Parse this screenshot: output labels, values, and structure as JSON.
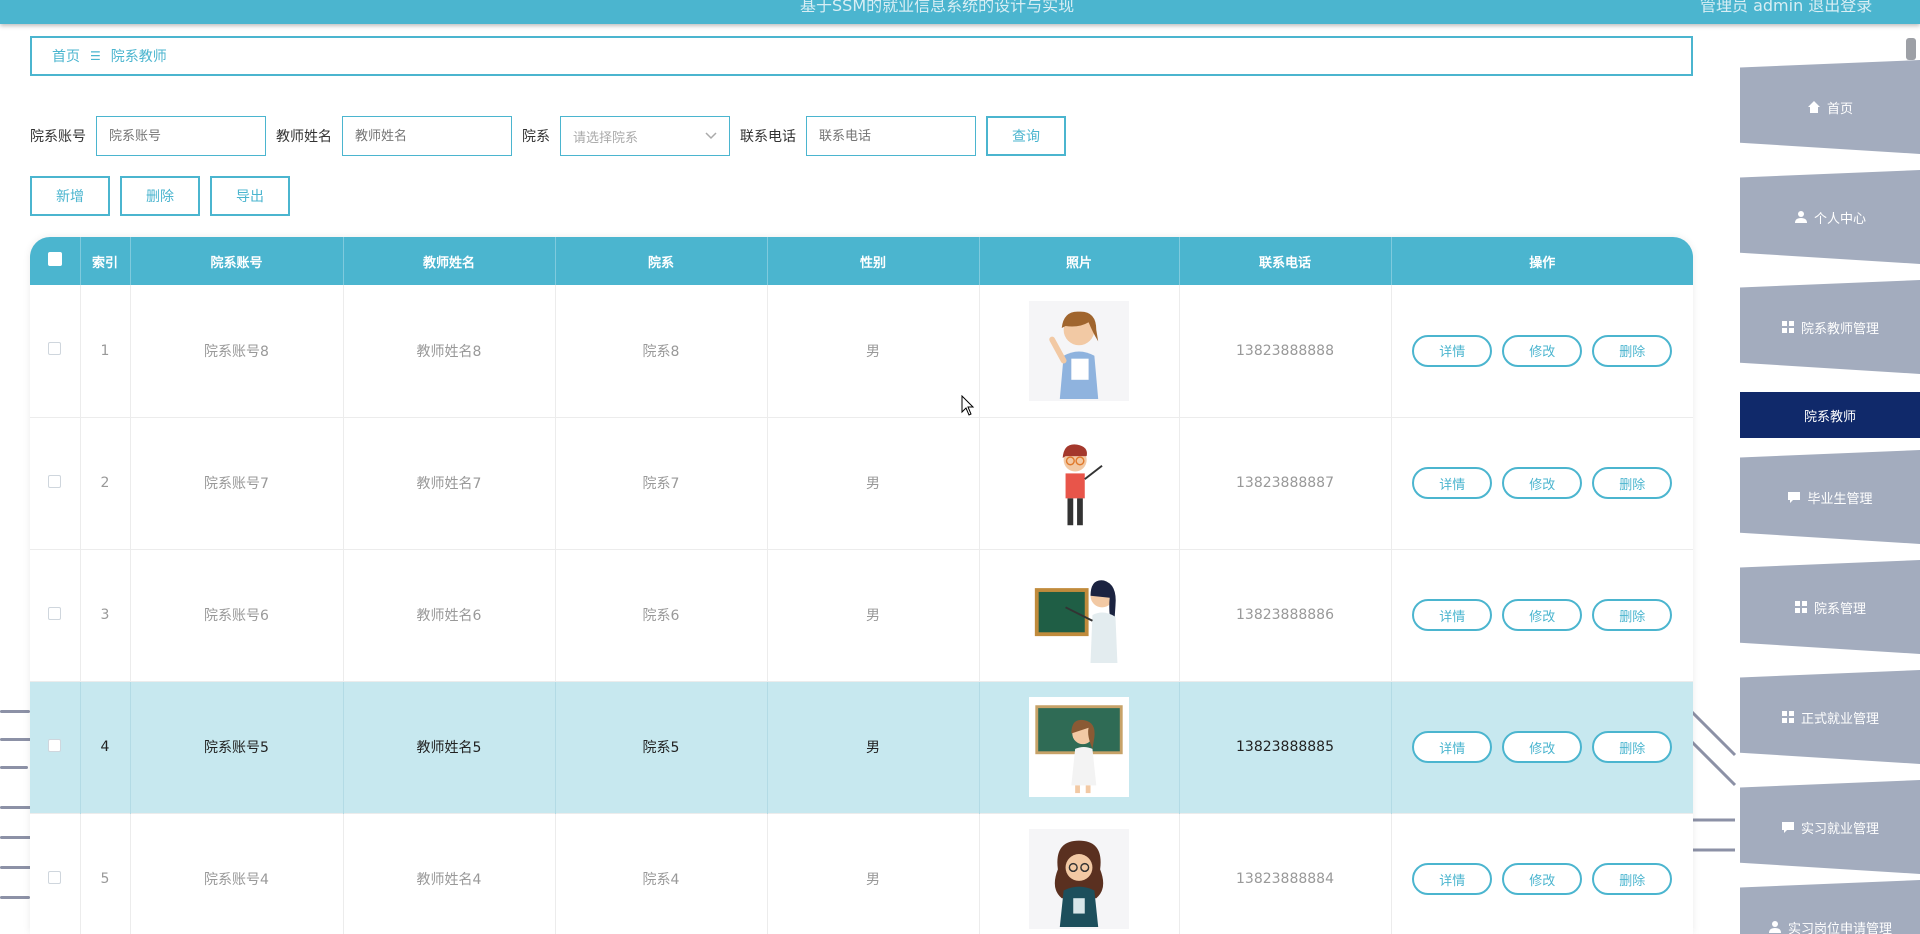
{
  "topbar": {
    "title": "基于SSM的就业信息系统的设计与实现",
    "user": "管理员 admin  退出登录"
  },
  "breadcrumb": {
    "home": "首页",
    "sep": "☰",
    "current": "院系教师"
  },
  "search": {
    "account_label": "院系账号",
    "account_placeholder": "院系账号",
    "name_label": "教师姓名",
    "name_placeholder": "教师姓名",
    "dept_label": "院系",
    "dept_placeholder": "请选择院系",
    "phone_label": "联系电话",
    "phone_placeholder": "联系电话",
    "query_button": "查询"
  },
  "actions": {
    "add": "新增",
    "delete": "删除",
    "export": "导出"
  },
  "table": {
    "headers": [
      "索引",
      "院系账号",
      "教师姓名",
      "院系",
      "性别",
      "照片",
      "联系电话",
      "操作"
    ],
    "rows": [
      {
        "index": "1",
        "account": "院系账号8",
        "name": "教师姓名8",
        "dept": "院系8",
        "gender": "男",
        "phone": "13823888888"
      },
      {
        "index": "2",
        "account": "院系账号7",
        "name": "教师姓名7",
        "dept": "院系7",
        "gender": "男",
        "phone": "13823888887"
      },
      {
        "index": "3",
        "account": "院系账号6",
        "name": "教师姓名6",
        "dept": "院系6",
        "gender": "男",
        "phone": "13823888886"
      },
      {
        "index": "4",
        "account": "院系账号5",
        "name": "教师姓名5",
        "dept": "院系5",
        "gender": "男",
        "phone": "13823888885"
      },
      {
        "index": "5",
        "account": "院系账号4",
        "name": "教师姓名4",
        "dept": "院系4",
        "gender": "男",
        "phone": "13823888884"
      }
    ],
    "op_detail": "详情",
    "op_edit": "修改",
    "op_delete": "删除"
  },
  "sidebar": {
    "items": [
      {
        "label": "首页",
        "icon": "home-icon"
      },
      {
        "label": "个人中心",
        "icon": "user-icon"
      },
      {
        "label": "院系教师管理",
        "icon": "grid-icon"
      },
      {
        "label": "院系教师",
        "icon": ""
      },
      {
        "label": "毕业生管理",
        "icon": "chat-icon"
      },
      {
        "label": "院系管理",
        "icon": "grid-icon"
      },
      {
        "label": "正式就业管理",
        "icon": "grid-icon"
      },
      {
        "label": "实习就业管理",
        "icon": "chat-icon"
      },
      {
        "label": "实习岗位申请管理",
        "icon": "user-icon"
      }
    ]
  },
  "colors": {
    "accent": "#4bb5cf",
    "sidebar": "#a3acbe",
    "sidebar_active": "#10296a",
    "row_highlight": "#c7e8ef"
  }
}
